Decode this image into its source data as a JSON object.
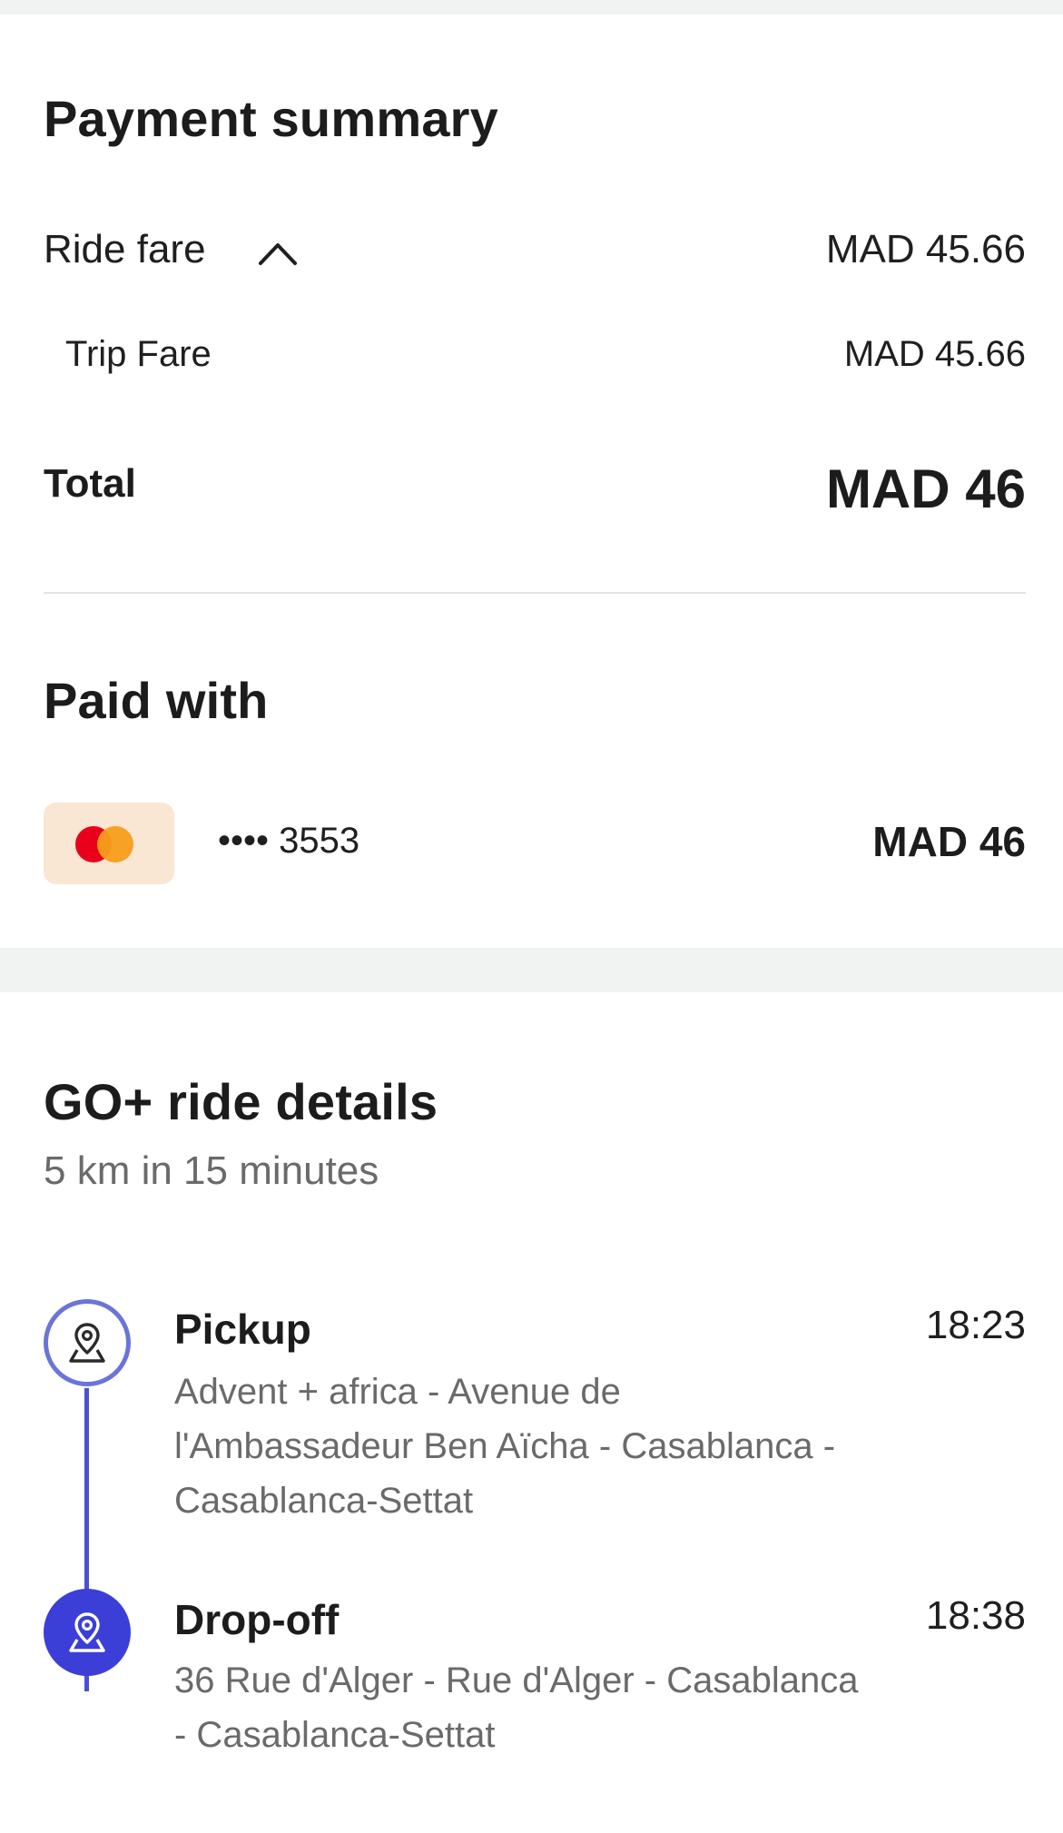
{
  "payment_summary": {
    "title": "Payment summary",
    "ride_fare_label": "Ride fare",
    "ride_fare_amount": "MAD 45.66",
    "trip_fare_label": "Trip Fare",
    "trip_fare_amount": "MAD 45.66",
    "total_label": "Total",
    "total_amount": "MAD 46"
  },
  "paid_with": {
    "title": "Paid with",
    "card_icon": "mastercard-icon",
    "card_masked": "•••• 3553",
    "amount": "MAD 46"
  },
  "ride_details": {
    "title": "GO+ ride details",
    "summary": "5 km in 15 minutes",
    "stops": [
      {
        "title": "Pickup",
        "address": "Advent + africa - Avenue de l'Ambassadeur Ben Aïcha - Casablanca - Casablanca-Settat",
        "time": "18:23",
        "icon": "map-pin-icon"
      },
      {
        "title": "Drop-off",
        "address": "36 Rue d'Alger - Rue d'Alger - Casablanca - Casablanca-Settat",
        "time": "18:38",
        "icon": "map-pin-icon"
      }
    ]
  },
  "colors": {
    "accent": "#3b3fd8",
    "pickup_ring": "#6b74d8",
    "card_badge_bg": "#f9e6d3",
    "page_bg": "#f0f3f2"
  }
}
